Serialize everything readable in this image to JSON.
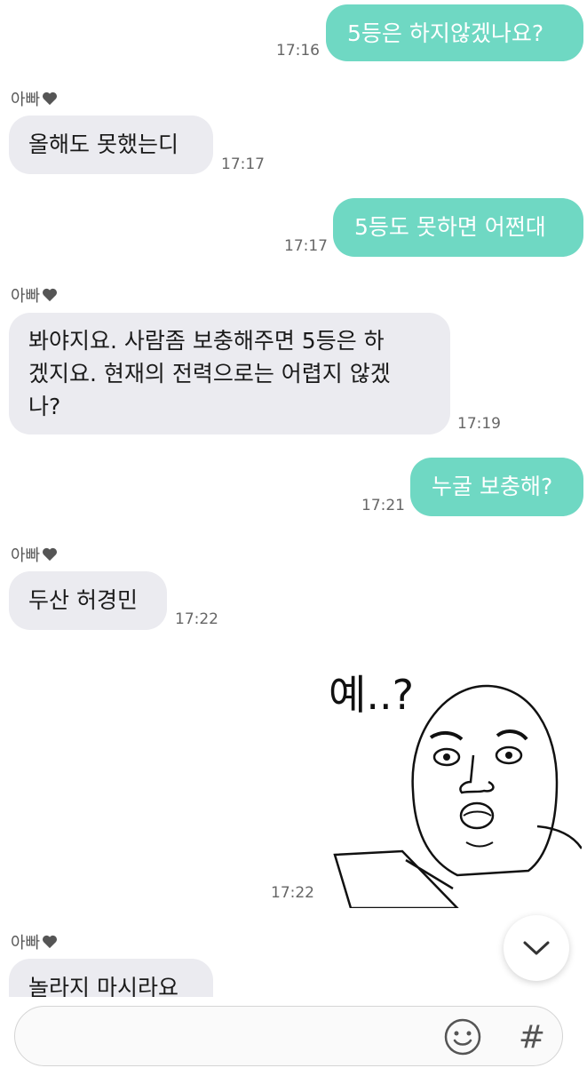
{
  "messages": [
    {
      "from": "me",
      "text": "5등은 하지않겠나요?",
      "time": "17:16"
    },
    {
      "from": "dad",
      "sender": "아빠",
      "text": "올해도 못했는디",
      "time": "17:17"
    },
    {
      "from": "me",
      "text": "5등도 못하면 어쩐대",
      "time": "17:17"
    },
    {
      "from": "dad",
      "sender": "아빠",
      "text": "봐야지요. 사람좀 보충해주면 5등은 하\n겠지요. 현재의 전력으로는 어렵지 않겠\n나?",
      "time": "17:19"
    },
    {
      "from": "me",
      "text": "누굴 보충해?",
      "time": "17:21"
    },
    {
      "from": "dad",
      "sender": "아빠",
      "text": "두산 허경민",
      "time": "17:22"
    },
    {
      "from": "me",
      "sticker_text": "예..?",
      "time": "17:22"
    },
    {
      "from": "dad",
      "sender": "아빠",
      "text": "놀라지 마시라요"
    }
  ],
  "icons": {
    "heart": "heart-icon",
    "scroll_down": "chevron-down-icon",
    "emoji": "emoji-icon",
    "hash": "hash-icon"
  },
  "input": {
    "hash_label": "#"
  },
  "colors": {
    "mine_bubble": "#6fd8c3",
    "theirs_bubble": "#ebebf0"
  }
}
